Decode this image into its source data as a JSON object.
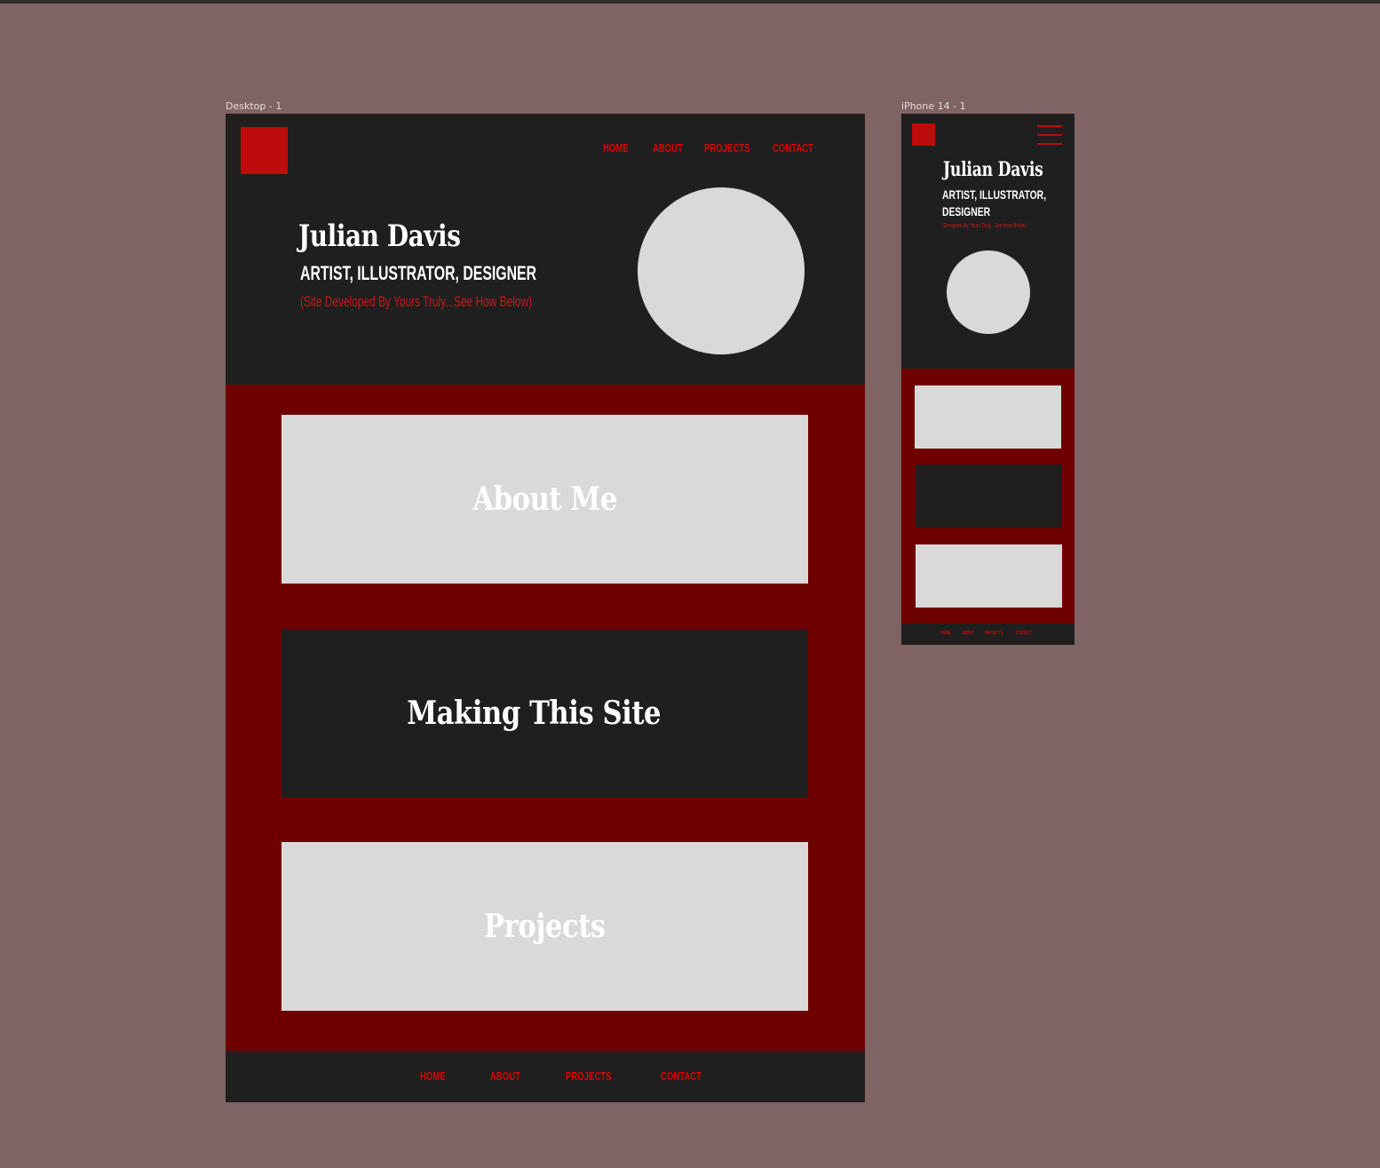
{
  "canvas": {
    "desktop_frame_label": "Desktop - 1",
    "iphone_frame_label": "iPhone 14 - 1"
  },
  "desktop": {
    "nav": [
      "HOME",
      "ABOUT",
      "PROJECTS",
      "CONTACT"
    ],
    "hero": {
      "name": "Julian Davis",
      "roles": "ARTIST, ILLUSTRATOR, DESIGNER",
      "note": "(Site Developed By Yours Truly...See How Below)"
    },
    "cards": [
      "About Me",
      "Making This Site",
      "Projects"
    ],
    "footer_nav": [
      "HOME",
      "ABOUT",
      "PROJECTS",
      "CONTACT"
    ]
  },
  "iphone": {
    "hero": {
      "name": "Julian Davis",
      "roles_line1": "ARTIST, ILLUSTRATOR,",
      "roles_line2": "DESIGNER",
      "note": "(Designed By Yours Truly...See How Below)"
    },
    "footer_nav": [
      "HOME",
      "ABOUT",
      "PROJECTS",
      "CONTACT"
    ]
  },
  "colors": {
    "canvas": "#806363",
    "frame_dark": "#1f1f1f",
    "section_red": "#6e0000",
    "accent_red": "#be0b0b",
    "nav_red": "#e10000",
    "placeholder_gray": "#d9d9d9"
  }
}
